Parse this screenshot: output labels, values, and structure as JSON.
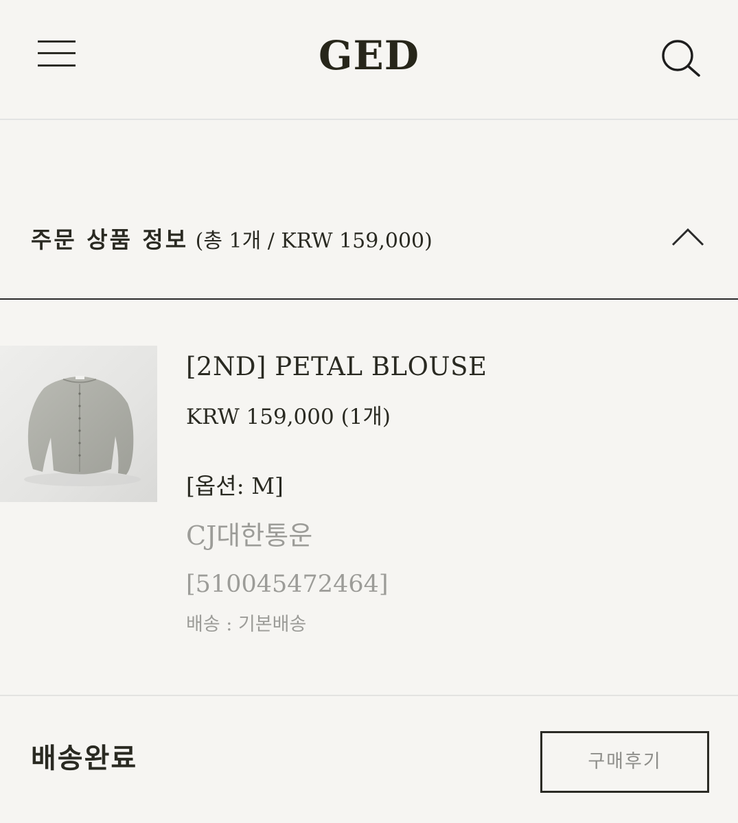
{
  "header": {
    "logo": "GED"
  },
  "order_info": {
    "title": "주문 상품 정보",
    "summary": "(총 1개 / KRW 159,000)"
  },
  "product": {
    "name": "[2ND] PETAL BLOUSE",
    "price": "KRW 159,000 (1개)",
    "option": "[옵션: M]",
    "carrier": "CJ대한통운",
    "tracking_number": "[510045472464]",
    "shipping_method": "배송 : 기본배송"
  },
  "order_status": {
    "status": "배송완료",
    "review_button": "구매후기"
  },
  "colors": {
    "background": "#f6f5f2",
    "text": "#2a2a22",
    "muted_text": "#9c9c98",
    "divider": "#e3e3e1"
  },
  "icons": {
    "menu": "hamburger-menu-icon",
    "search": "search-icon",
    "collapse": "chevron-up-icon"
  }
}
